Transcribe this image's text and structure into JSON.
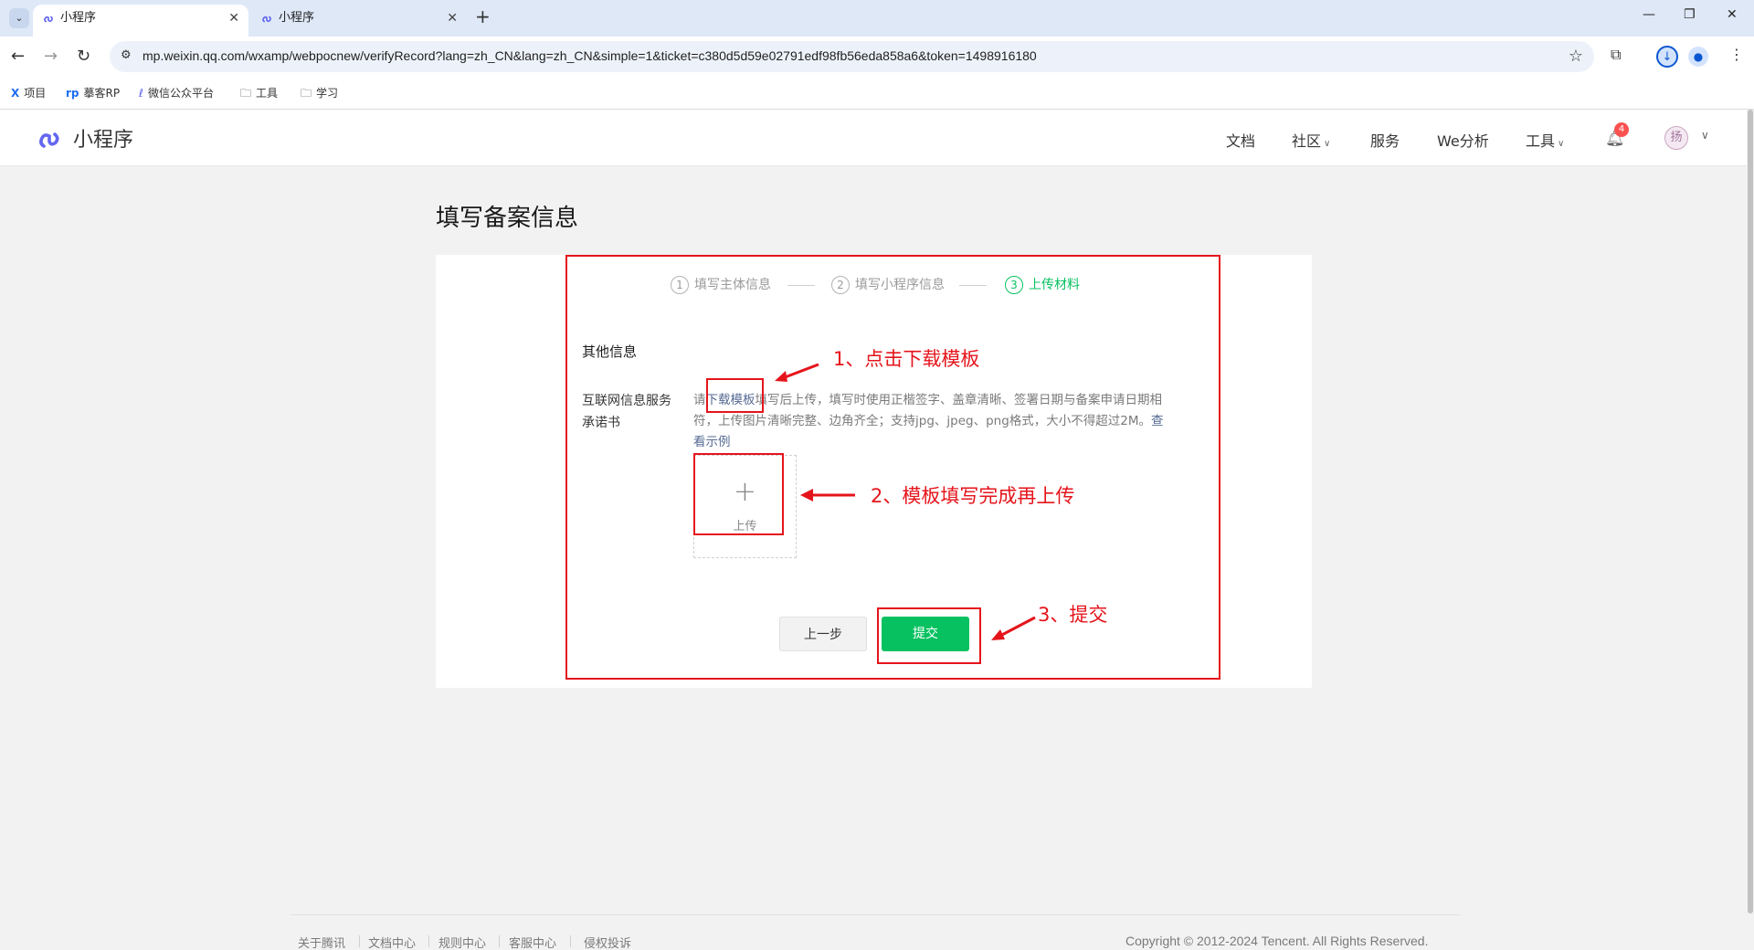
{
  "browser": {
    "tabs": [
      {
        "title": "小程序",
        "active": true
      },
      {
        "title": "小程序",
        "active": false
      }
    ],
    "url": "mp.weixin.qq.com/wxamp/webpocnew/verifyRecord?lang=zh_CN&lang=zh_CN&simple=1&ticket=c380d5d59e02791edf98fb56eda858a6&token=1498916180",
    "bookmarks": [
      "项目",
      "摹客RP",
      "微信公众平台",
      "工具",
      "学习"
    ]
  },
  "site": {
    "logo_text": "小程序",
    "nav": [
      "文档",
      "社区",
      "服务",
      "We分析",
      "工具"
    ],
    "notification_count": "4",
    "avatar_glyph": "扬"
  },
  "page": {
    "title": "填写备案信息",
    "steps": [
      {
        "num": "1",
        "label": "填写主体信息"
      },
      {
        "num": "2",
        "label": "填写小程序信息"
      },
      {
        "num": "3",
        "label": "上传材料"
      }
    ],
    "section_title": "其他信息",
    "field_label": "互联网信息服务承诺书",
    "desc_prefix": "请",
    "desc_link": "下载模板",
    "desc_body": "填写后上传，填写时使用正楷签字、盖章清晰、签署日期与备案申请日期相符，上传图片清晰完整、边角齐全；支持jpg、jpeg、png格式，大小不得超过2M。",
    "desc_example": "查看示例",
    "upload_plus": "+",
    "upload_label": "上传",
    "prev_button": "上一步",
    "submit_button": "提交"
  },
  "annotations": [
    "1、点击下载模板",
    "2、模板填写完成再上传",
    "3、提交"
  ],
  "footer": {
    "links": [
      "关于腾讯",
      "文档中心",
      "规则中心",
      "客服中心",
      "侵权投诉"
    ],
    "copyright": "Copyright © 2012-2024 Tencent. All Rights Reserved."
  },
  "colors": {
    "accent_green": "#07c160",
    "annotation_red": "#e5141b",
    "link_blue": "#576b95"
  }
}
